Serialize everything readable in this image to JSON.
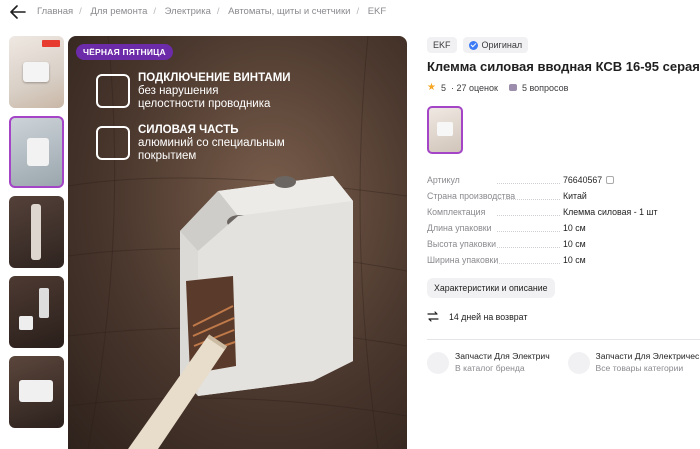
{
  "breadcrumb": [
    "Главная",
    "Для ремонта",
    "Электрика",
    "Автоматы, щиты и счетчики",
    "EKF"
  ],
  "hero": {
    "badge": "ЧЁРНАЯ ПЯТНИЦА",
    "features": [
      {
        "title": "ПОДКЛЮЧЕНИЕ ВИНТАМИ",
        "sub1": "без нарушения",
        "sub2": "целостности проводника"
      },
      {
        "title": "СИЛОВАЯ ЧАСТЬ",
        "sub1": "алюминий со специальным",
        "sub2": "покрытием"
      }
    ],
    "logo": "EKF"
  },
  "product": {
    "brand": "EKF",
    "original": "Оригинал",
    "title": "Клемма силовая вводная КСВ 16-95 серая",
    "rating": "5",
    "reviews": "· 27 оценок",
    "questions": "5 вопросов"
  },
  "specs": [
    {
      "k": "Артикул",
      "v": "76640567"
    },
    {
      "k": "Страна производства",
      "v": "Китай"
    },
    {
      "k": "Комплектация",
      "v": "Клемма силовая - 1 шт"
    },
    {
      "k": "Длина упаковки",
      "v": "10 см"
    },
    {
      "k": "Высота упаковки",
      "v": "10 см"
    },
    {
      "k": "Ширина упаковки",
      "v": "10 см"
    }
  ],
  "chars_button": "Характеристики и описание",
  "return_text": "14 дней на возврат",
  "cards": [
    {
      "title": "Запчасти Для Электрич",
      "sub": "В каталог бренда"
    },
    {
      "title": "Запчасти Для Электричес",
      "sub": "Все товары категории"
    }
  ],
  "colors": {
    "accent": "#a445c8",
    "badge": "#6c2ba8",
    "verified": "#3c7bf5",
    "star": "#f5a623"
  },
  "icons": [
    "back-arrow-icon",
    "verified-check-icon",
    "star-icon",
    "question-icon",
    "copy-icon",
    "return-icon",
    "brand-icon",
    "category-icon",
    "screw-icon",
    "power-part-icon"
  ]
}
